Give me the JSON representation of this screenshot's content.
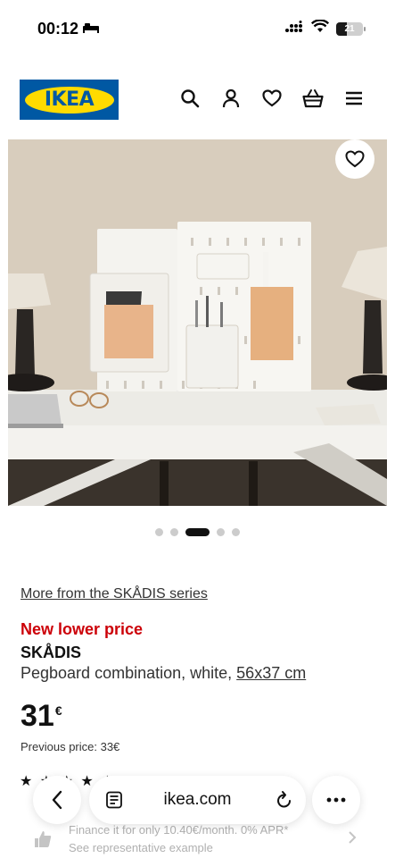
{
  "status_bar": {
    "time": "00:12",
    "battery": "21",
    "icons": [
      "bed-icon",
      "signal-icon",
      "wifi-icon",
      "battery-icon"
    ]
  },
  "header": {
    "logo_text": "IKEA",
    "icons": [
      "search-icon",
      "account-icon",
      "wishlist-heart-icon",
      "basket-icon",
      "menu-icon"
    ],
    "brand_colors": {
      "blue": "#0058a3",
      "yellow": "#ffdb00"
    }
  },
  "carousel": {
    "slide_count": 5,
    "active_index": 2
  },
  "product": {
    "series_link": "More from the SKÅDIS series",
    "promo_label": "New lower price",
    "promo_color": "#cc0008",
    "name": "SKÅDIS",
    "description": "Pegboard combination, white,",
    "size": "56x37 cm",
    "price": "31",
    "currency": "€",
    "previous_price": "Previous price: 33€",
    "rating_stars": "★ ★ ★ ★ ★"
  },
  "finance": {
    "line1": "Finance it for only 10.40€/month. 0% APR*",
    "line2": "See representative example"
  },
  "browser": {
    "url": "ikea.com",
    "icons": [
      "back-icon",
      "reader-icon",
      "reload-icon",
      "more-icon"
    ]
  }
}
